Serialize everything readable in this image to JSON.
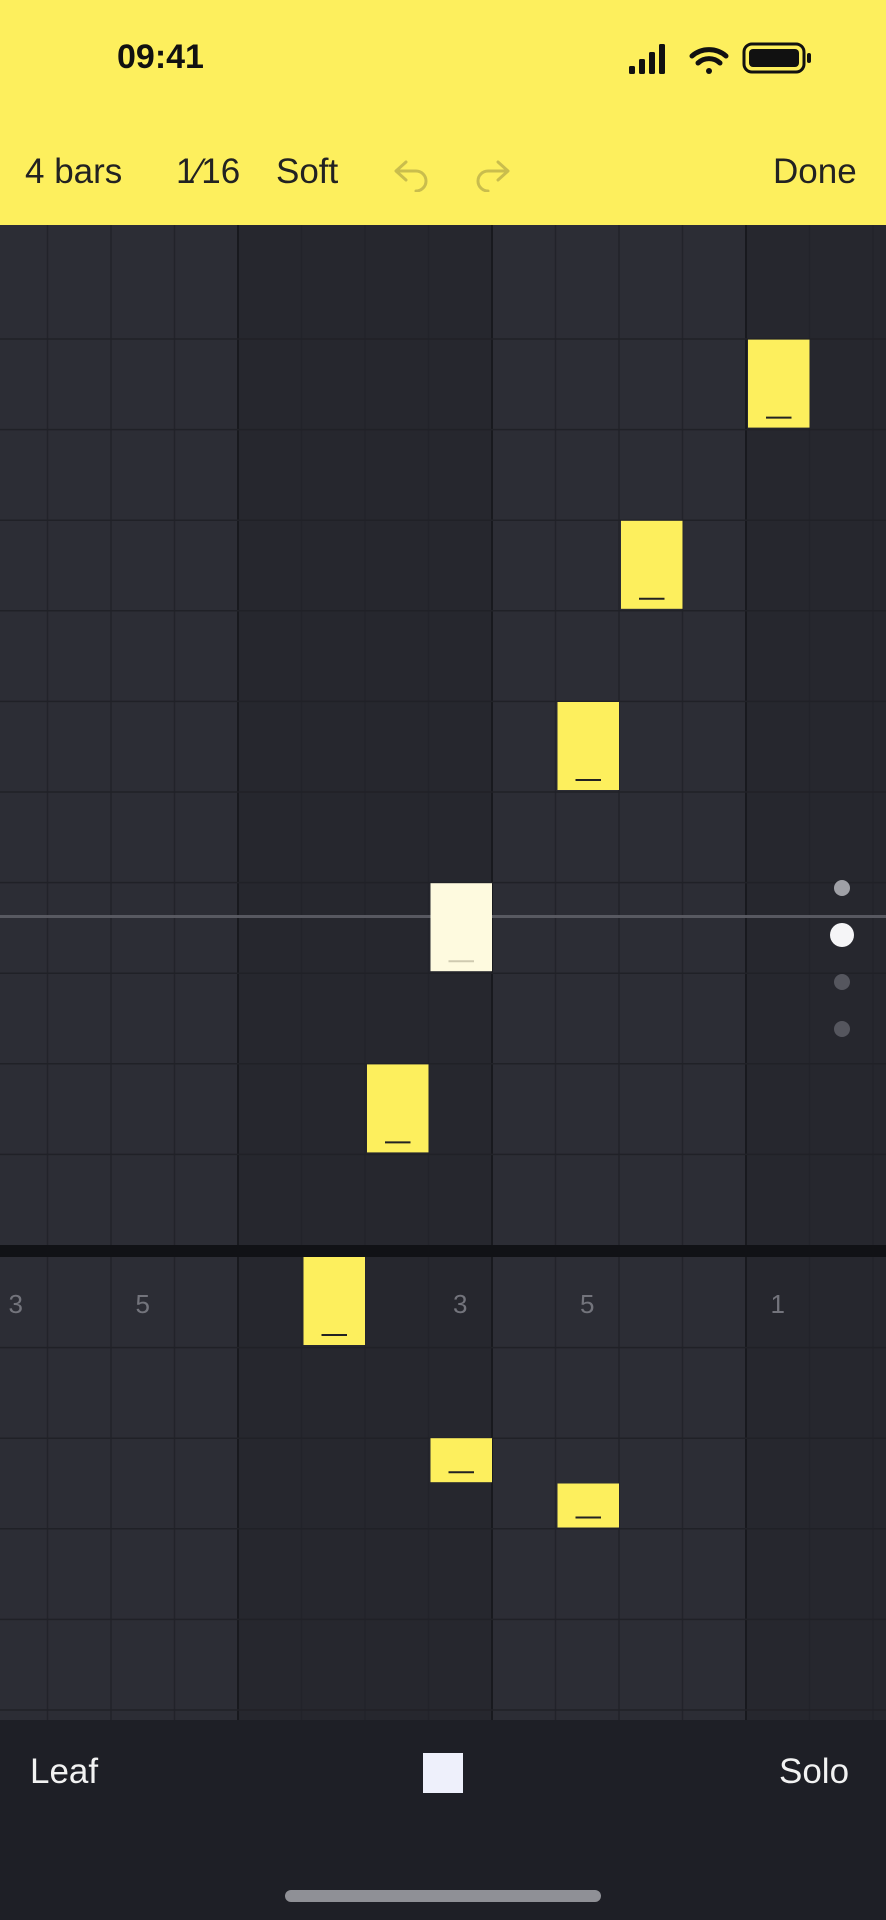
{
  "status": {
    "time": "09:41"
  },
  "toolbar": {
    "bars": "4 bars",
    "division": "1⁄16",
    "preset": "Soft",
    "done": "Done"
  },
  "melody_notes": [
    {
      "step": 12,
      "row": 1,
      "selected": false
    },
    {
      "step": 10,
      "row": 3,
      "selected": false
    },
    {
      "step": 9,
      "row": 5,
      "selected": false
    },
    {
      "step": 7,
      "row": 7,
      "selected": true
    },
    {
      "step": 6,
      "row": 9,
      "selected": false
    }
  ],
  "bass_notes": [
    {
      "step": 5,
      "row": 0,
      "length": 1
    },
    {
      "step": 7,
      "row": 2,
      "length": 0.5
    },
    {
      "step": 9,
      "row": 2.5,
      "length": 0.5
    }
  ],
  "bass_beat_labels": [
    "3",
    "5",
    "3",
    "5",
    "1"
  ],
  "page_dots": {
    "count": 4,
    "active": 1
  },
  "bottom": {
    "instrument": "Leaf",
    "mode": "Solo"
  },
  "colors": {
    "accent": "#fdef5d",
    "selected_note": "#fefadf",
    "grid": "#2a2b33"
  }
}
